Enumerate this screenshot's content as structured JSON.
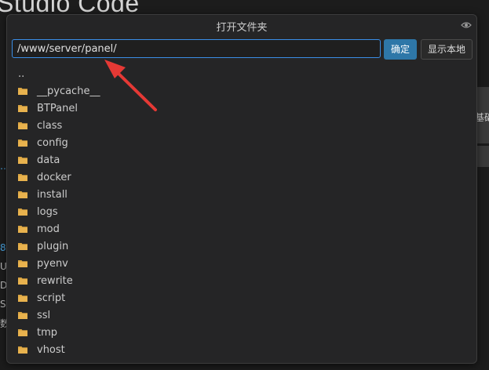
{
  "background": {
    "app_title": "Studio Code",
    "right_box_char": "基础",
    "left_chars": [
      "…",
      "8",
      "U",
      "D",
      "S",
      "数"
    ]
  },
  "dialog": {
    "title": "打开文件夹",
    "path_value": "/www/server/panel/",
    "confirm_label": "确定",
    "show_local_label": "显示本地",
    "parent_entry": "..",
    "folders": [
      "__pycache__",
      "BTPanel",
      "class",
      "config",
      "data",
      "docker",
      "install",
      "logs",
      "mod",
      "plugin",
      "pyenv",
      "rewrite",
      "script",
      "ssl",
      "tmp",
      "vhost"
    ]
  },
  "colors": {
    "accent": "#2e77a8",
    "input_border": "#3a8ee6",
    "folder": "#d9a441",
    "annotation_arrow": "#e53935"
  }
}
